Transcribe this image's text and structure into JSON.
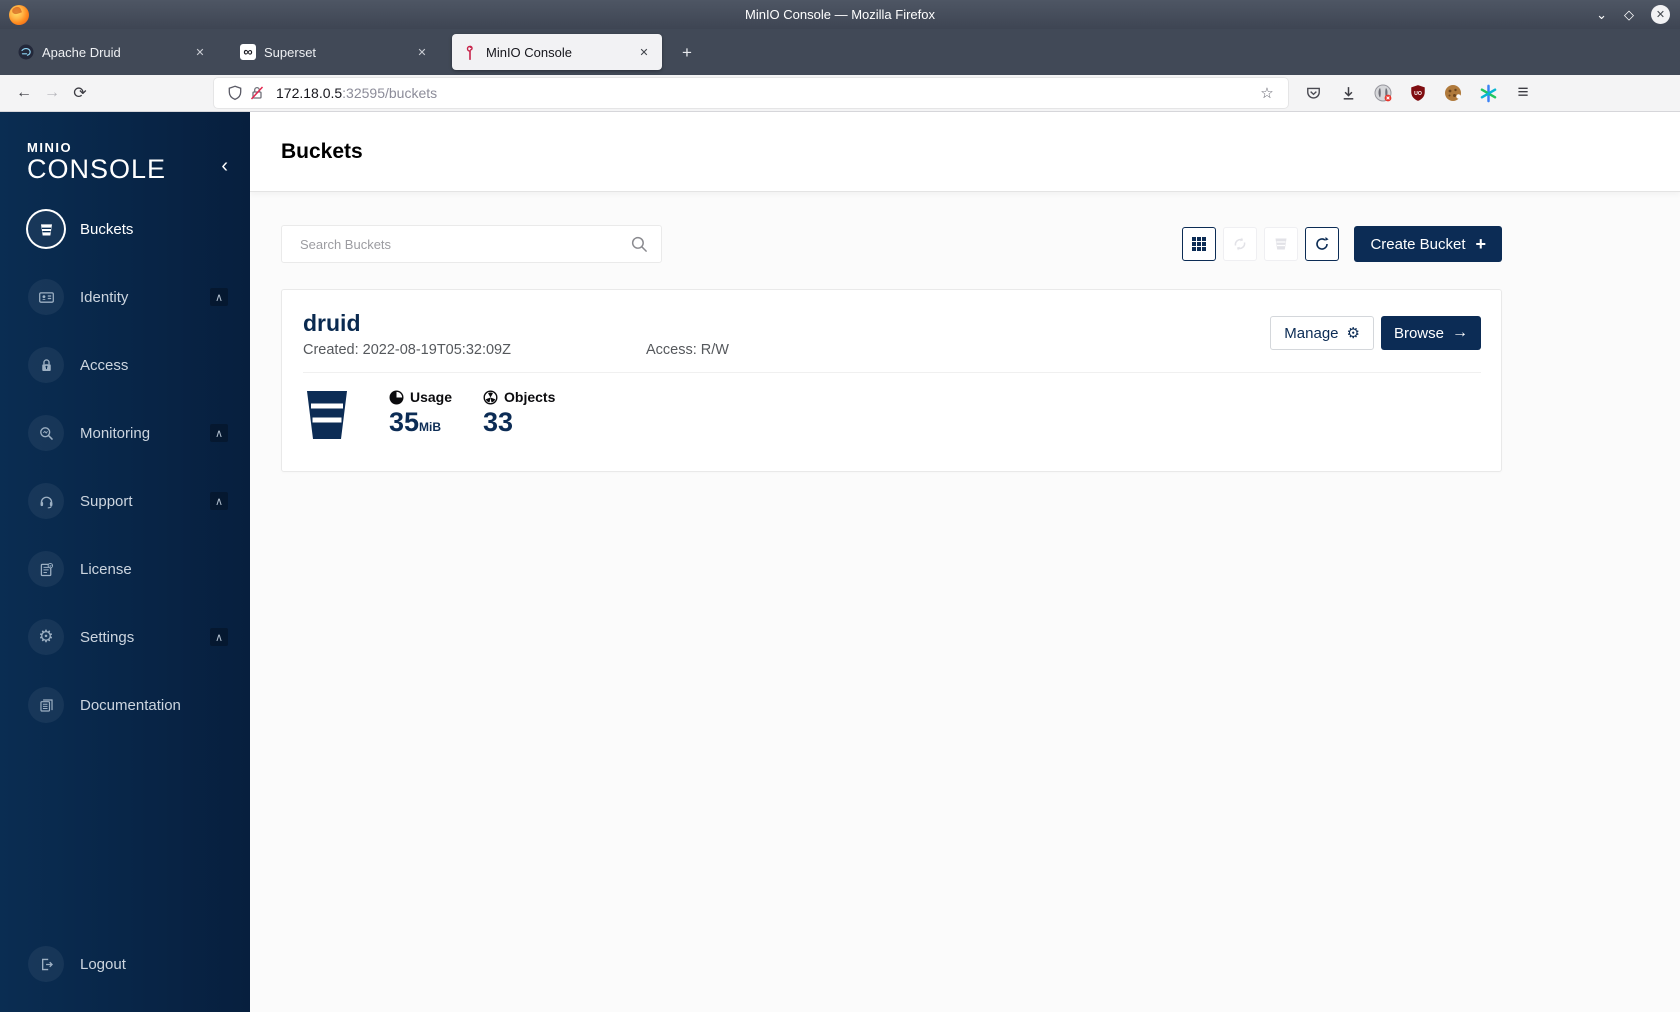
{
  "browser": {
    "window_title": "MinIO Console — Mozilla Firefox",
    "tabs": [
      {
        "label": "Apache Druid",
        "active": false
      },
      {
        "label": "Superset",
        "active": false
      },
      {
        "label": "MinIO Console",
        "active": true
      }
    ],
    "url": {
      "host": "172.18.0.5",
      "rest": ":32595/buckets"
    }
  },
  "glyphs": {
    "close": "✕",
    "plus": "+",
    "back": "←",
    "forward": "→",
    "reload": "⟳",
    "hamburger": "≡",
    "minimize": "⌄",
    "maximize": "◇",
    "collapse": "‹",
    "chevron_up": "∧",
    "infinity": "∞",
    "gear": "⚙",
    "arrow_right": "→",
    "star": "☆"
  },
  "sidebar": {
    "logo_top": "MINIO",
    "logo_bottom": "CONSOLE",
    "items": [
      {
        "label": "Buckets",
        "active": true,
        "expandable": false
      },
      {
        "label": "Identity",
        "active": false,
        "expandable": true
      },
      {
        "label": "Access",
        "active": false,
        "expandable": false
      },
      {
        "label": "Monitoring",
        "active": false,
        "expandable": true
      },
      {
        "label": "Support",
        "active": false,
        "expandable": true
      },
      {
        "label": "License",
        "active": false,
        "expandable": false
      },
      {
        "label": "Settings",
        "active": false,
        "expandable": true
      },
      {
        "label": "Documentation",
        "active": false,
        "expandable": false
      }
    ],
    "logout_label": "Logout"
  },
  "main": {
    "page_title": "Buckets",
    "search_placeholder": "Search Buckets",
    "create_button_label": "Create Bucket",
    "bucket": {
      "name": "druid",
      "created_label": "Created: 2022-08-19T05:32:09Z",
      "access_label": "Access: R/W",
      "manage_label": "Manage",
      "browse_label": "Browse",
      "usage_label": "Usage",
      "usage_value": "35",
      "usage_unit": "MiB",
      "objects_label": "Objects",
      "objects_value": "33"
    }
  },
  "colors": {
    "navy": "#0c2c55",
    "sidebar_start": "#0a2d52",
    "sidebar_end": "#071f3e",
    "danger_red": "#e22850"
  }
}
